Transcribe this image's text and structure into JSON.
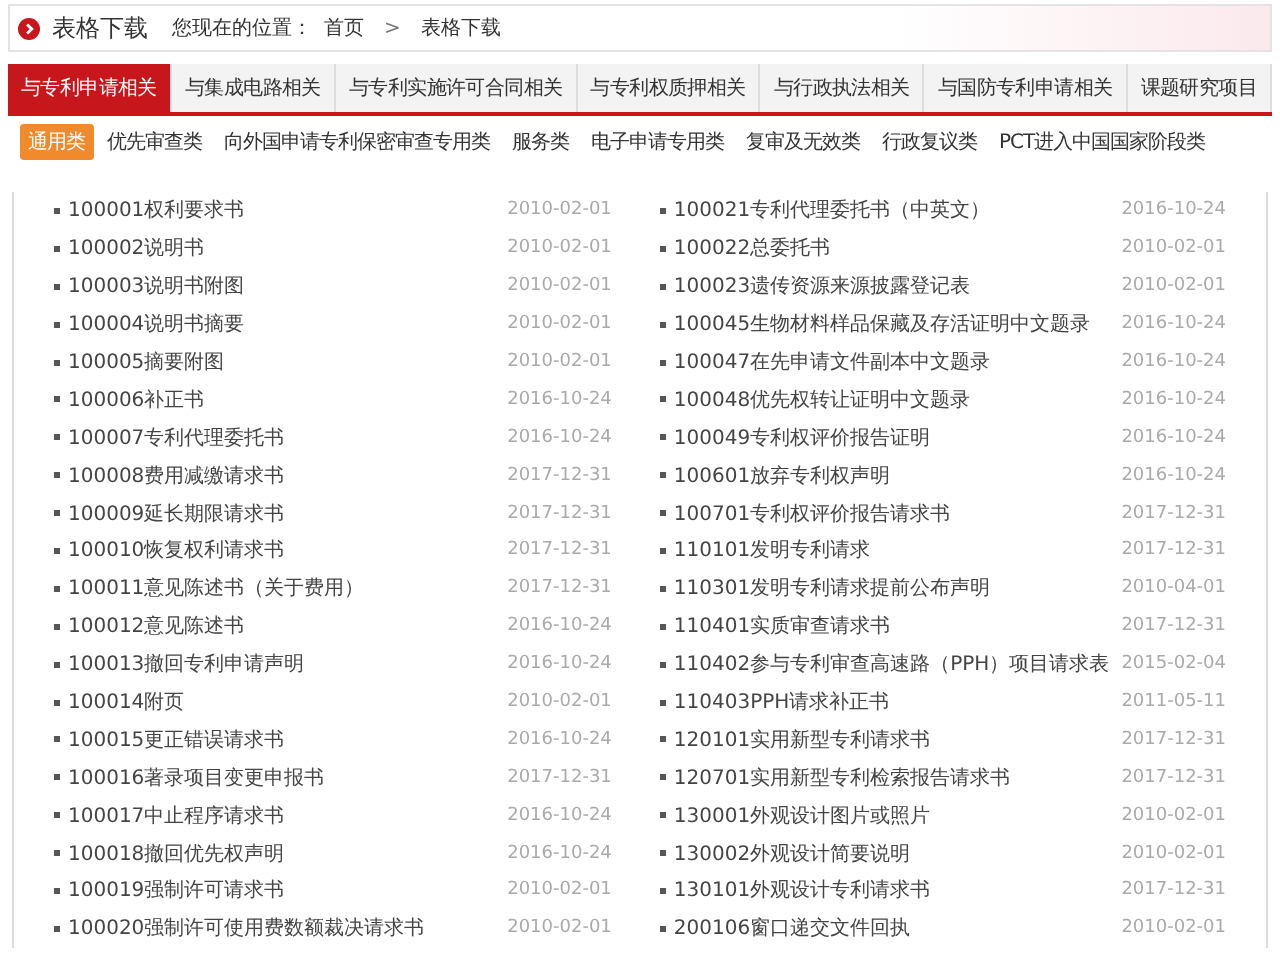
{
  "header": {
    "title": "表格下载",
    "location_label": "您现在的位置：",
    "breadcrumb": [
      "首页",
      "表格下载"
    ],
    "separator": ">"
  },
  "tabs": [
    {
      "label": "与专利申请相关",
      "selected": true
    },
    {
      "label": "与集成电路相关",
      "selected": false
    },
    {
      "label": "与专利实施许可合同相关",
      "selected": false
    },
    {
      "label": "与专利权质押相关",
      "selected": false
    },
    {
      "label": "与行政执法相关",
      "selected": false
    },
    {
      "label": "与国防专利申请相关",
      "selected": false
    },
    {
      "label": "课题研究项目",
      "selected": false
    }
  ],
  "subtabs": [
    {
      "label": "通用类",
      "selected": true
    },
    {
      "label": "优先审查类",
      "selected": false
    },
    {
      "label": "向外国申请专利保密审查专用类",
      "selected": false
    },
    {
      "label": "服务类",
      "selected": false
    },
    {
      "label": "电子申请专用类",
      "selected": false
    },
    {
      "label": "复审及无效类",
      "selected": false
    },
    {
      "label": "行政复议类",
      "selected": false
    },
    {
      "label": "PCT进入中国国家阶段类",
      "selected": false
    }
  ],
  "columns": [
    [
      {
        "name": "100001权利要求书",
        "date": "2010-02-01"
      },
      {
        "name": "100002说明书",
        "date": "2010-02-01"
      },
      {
        "name": "100003说明书附图",
        "date": "2010-02-01"
      },
      {
        "name": "100004说明书摘要",
        "date": "2010-02-01"
      },
      {
        "name": "100005摘要附图",
        "date": "2010-02-01"
      },
      {
        "name": "100006补正书",
        "date": "2016-10-24"
      },
      {
        "name": "100007专利代理委托书",
        "date": "2016-10-24"
      },
      {
        "name": "100008费用减缴请求书",
        "date": "2017-12-31"
      },
      {
        "name": "100009延长期限请求书",
        "date": "2017-12-31"
      },
      {
        "name": "100010恢复权利请求书",
        "date": "2017-12-31"
      },
      {
        "name": "100011意见陈述书（关于费用）",
        "date": "2017-12-31"
      },
      {
        "name": "100012意见陈述书",
        "date": "2016-10-24"
      },
      {
        "name": "100013撤回专利申请声明",
        "date": "2016-10-24"
      },
      {
        "name": "100014附页",
        "date": "2010-02-01"
      },
      {
        "name": "100015更正错误请求书",
        "date": "2016-10-24"
      },
      {
        "name": "100016著录项目变更申报书",
        "date": "2017-12-31"
      },
      {
        "name": "100017中止程序请求书",
        "date": "2016-10-24"
      },
      {
        "name": "100018撤回优先权声明",
        "date": "2016-10-24"
      },
      {
        "name": "100019强制许可请求书",
        "date": "2010-02-01"
      },
      {
        "name": "100020强制许可使用费数额裁决请求书",
        "date": "2010-02-01"
      }
    ],
    [
      {
        "name": "100021专利代理委托书（中英文）",
        "date": "2016-10-24"
      },
      {
        "name": "100022总委托书",
        "date": "2010-02-01"
      },
      {
        "name": "100023遗传资源来源披露登记表",
        "date": "2010-02-01"
      },
      {
        "name": "100045生物材料样品保藏及存活证明中文题录",
        "date": "2016-10-24"
      },
      {
        "name": "100047在先申请文件副本中文题录",
        "date": "2016-10-24"
      },
      {
        "name": "100048优先权转让证明中文题录",
        "date": "2016-10-24"
      },
      {
        "name": "100049专利权评价报告证明",
        "date": "2016-10-24"
      },
      {
        "name": "100601放弃专利权声明",
        "date": "2016-10-24"
      },
      {
        "name": "100701专利权评价报告请求书",
        "date": "2017-12-31"
      },
      {
        "name": "110101发明专利请求",
        "date": "2017-12-31"
      },
      {
        "name": "110301发明专利请求提前公布声明",
        "date": "2010-04-01"
      },
      {
        "name": "110401实质审查请求书",
        "date": "2017-12-31"
      },
      {
        "name": "110402参与专利审查高速路（PPH）项目请求表",
        "date": "2015-02-04"
      },
      {
        "name": "110403PPH请求补正书",
        "date": "2011-05-11"
      },
      {
        "name": "120101实用新型专利请求书",
        "date": "2017-12-31"
      },
      {
        "name": "120701实用新型专利检索报告请求书",
        "date": "2017-12-31"
      },
      {
        "name": "130001外观设计图片或照片",
        "date": "2010-02-01"
      },
      {
        "name": "130002外观设计简要说明",
        "date": "2010-02-01"
      },
      {
        "name": "130101外观设计专利请求书",
        "date": "2017-12-31"
      },
      {
        "name": "200106窗口递交文件回执",
        "date": "2010-02-01"
      }
    ]
  ]
}
